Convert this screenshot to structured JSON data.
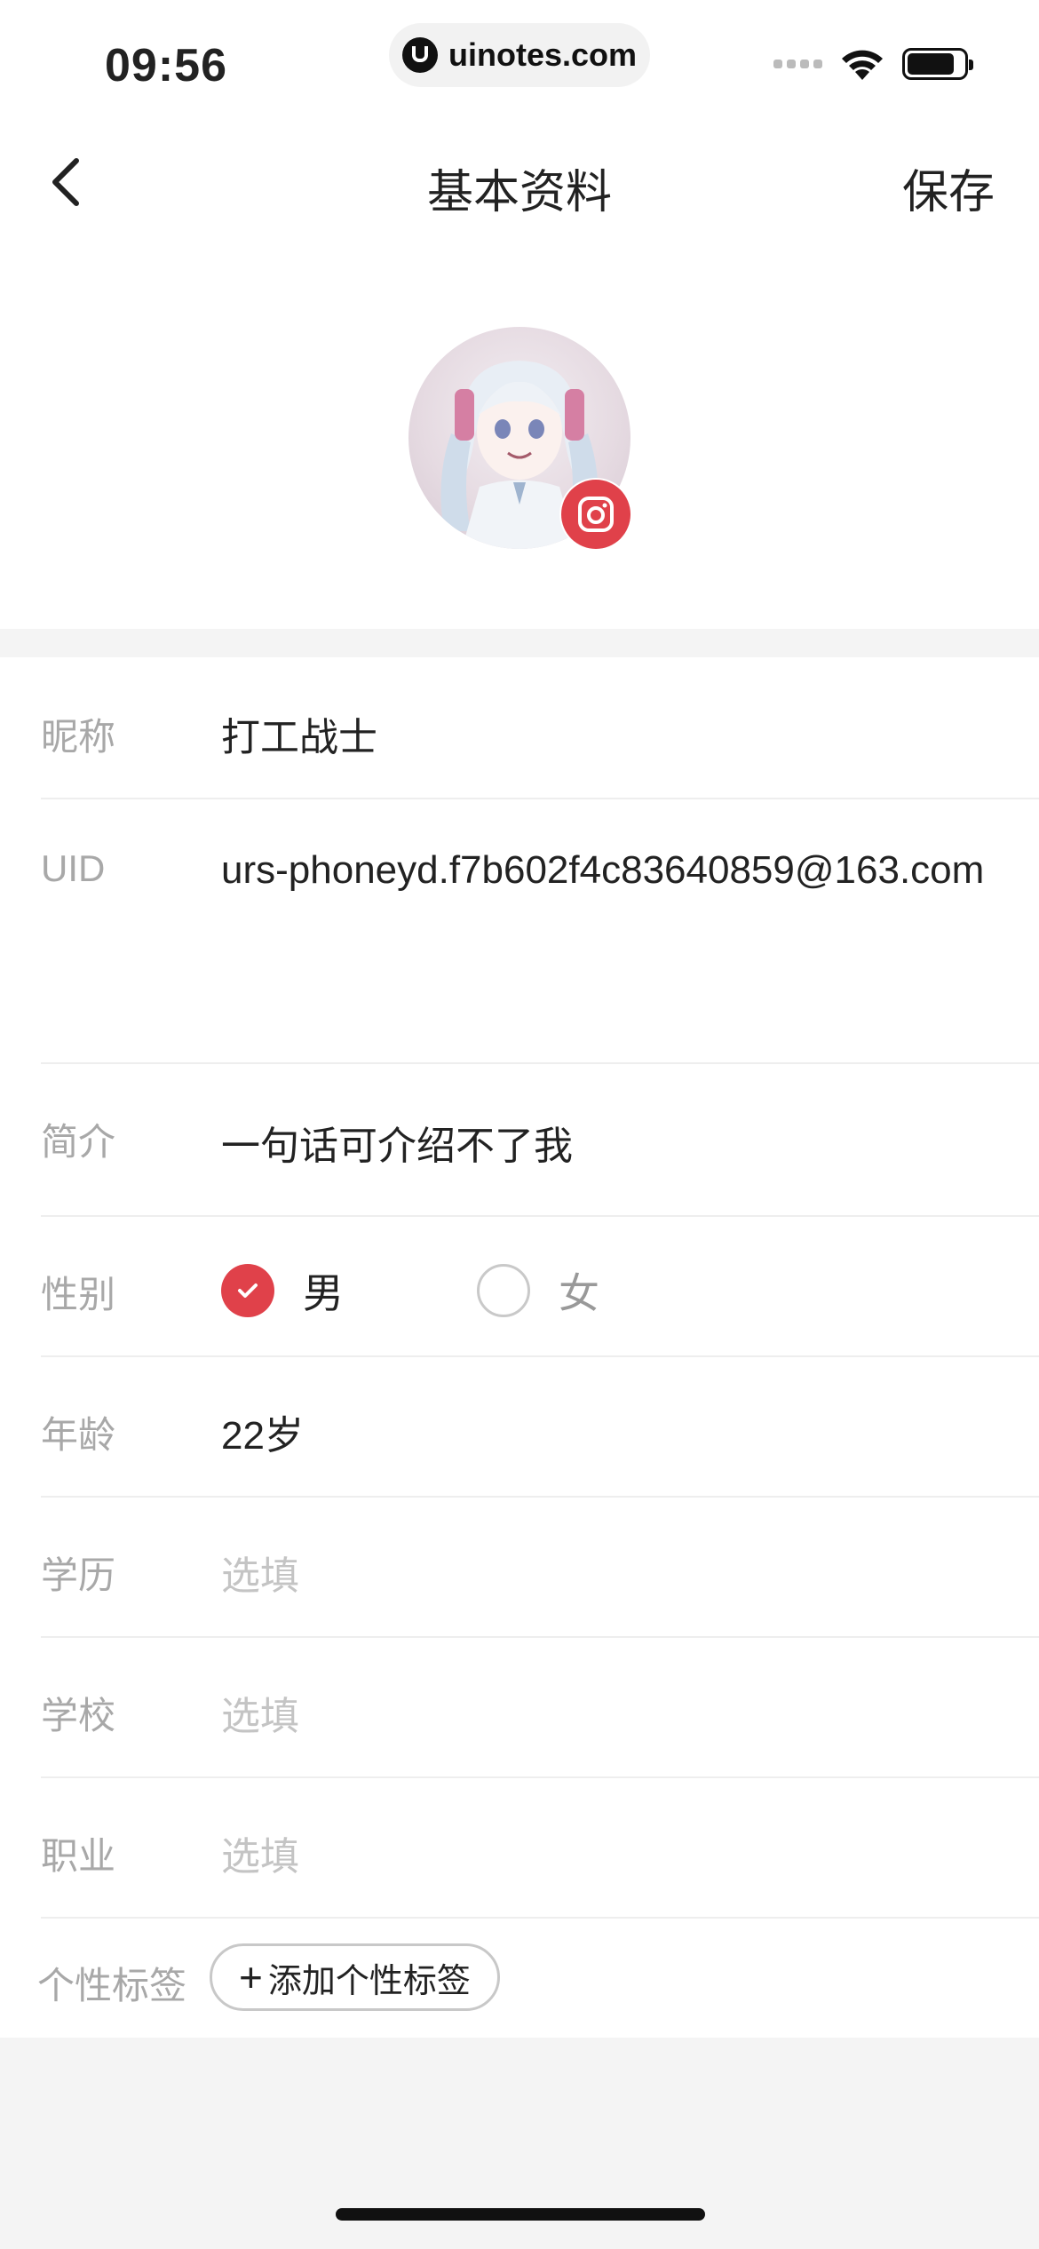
{
  "status_bar": {
    "time": "09:56",
    "url": "uinotes.com"
  },
  "nav": {
    "title": "基本资料",
    "save_label": "保存"
  },
  "form": {
    "nickname": {
      "label": "昵称",
      "value": "打工战士"
    },
    "uid": {
      "label": "UID",
      "value": "urs-phoneyd.f7b602f4c83640859@163.com"
    },
    "bio": {
      "label": "简介",
      "value": "一句话可介绍不了我"
    },
    "gender": {
      "label": "性别",
      "options": [
        {
          "label": "男",
          "selected": true
        },
        {
          "label": "女",
          "selected": false
        }
      ]
    },
    "age": {
      "label": "年龄",
      "value": "22岁"
    },
    "education": {
      "label": "学历",
      "placeholder": "选填"
    },
    "school": {
      "label": "学校",
      "placeholder": "选填"
    },
    "occupation": {
      "label": "职业",
      "placeholder": "选填"
    },
    "tags": {
      "label": "个性标签",
      "add_button_label": "添加个性标签"
    }
  },
  "colors": {
    "accent": "#e0414a",
    "label_gray": "#a8a8a8",
    "placeholder_gray": "#c4c4c4"
  }
}
